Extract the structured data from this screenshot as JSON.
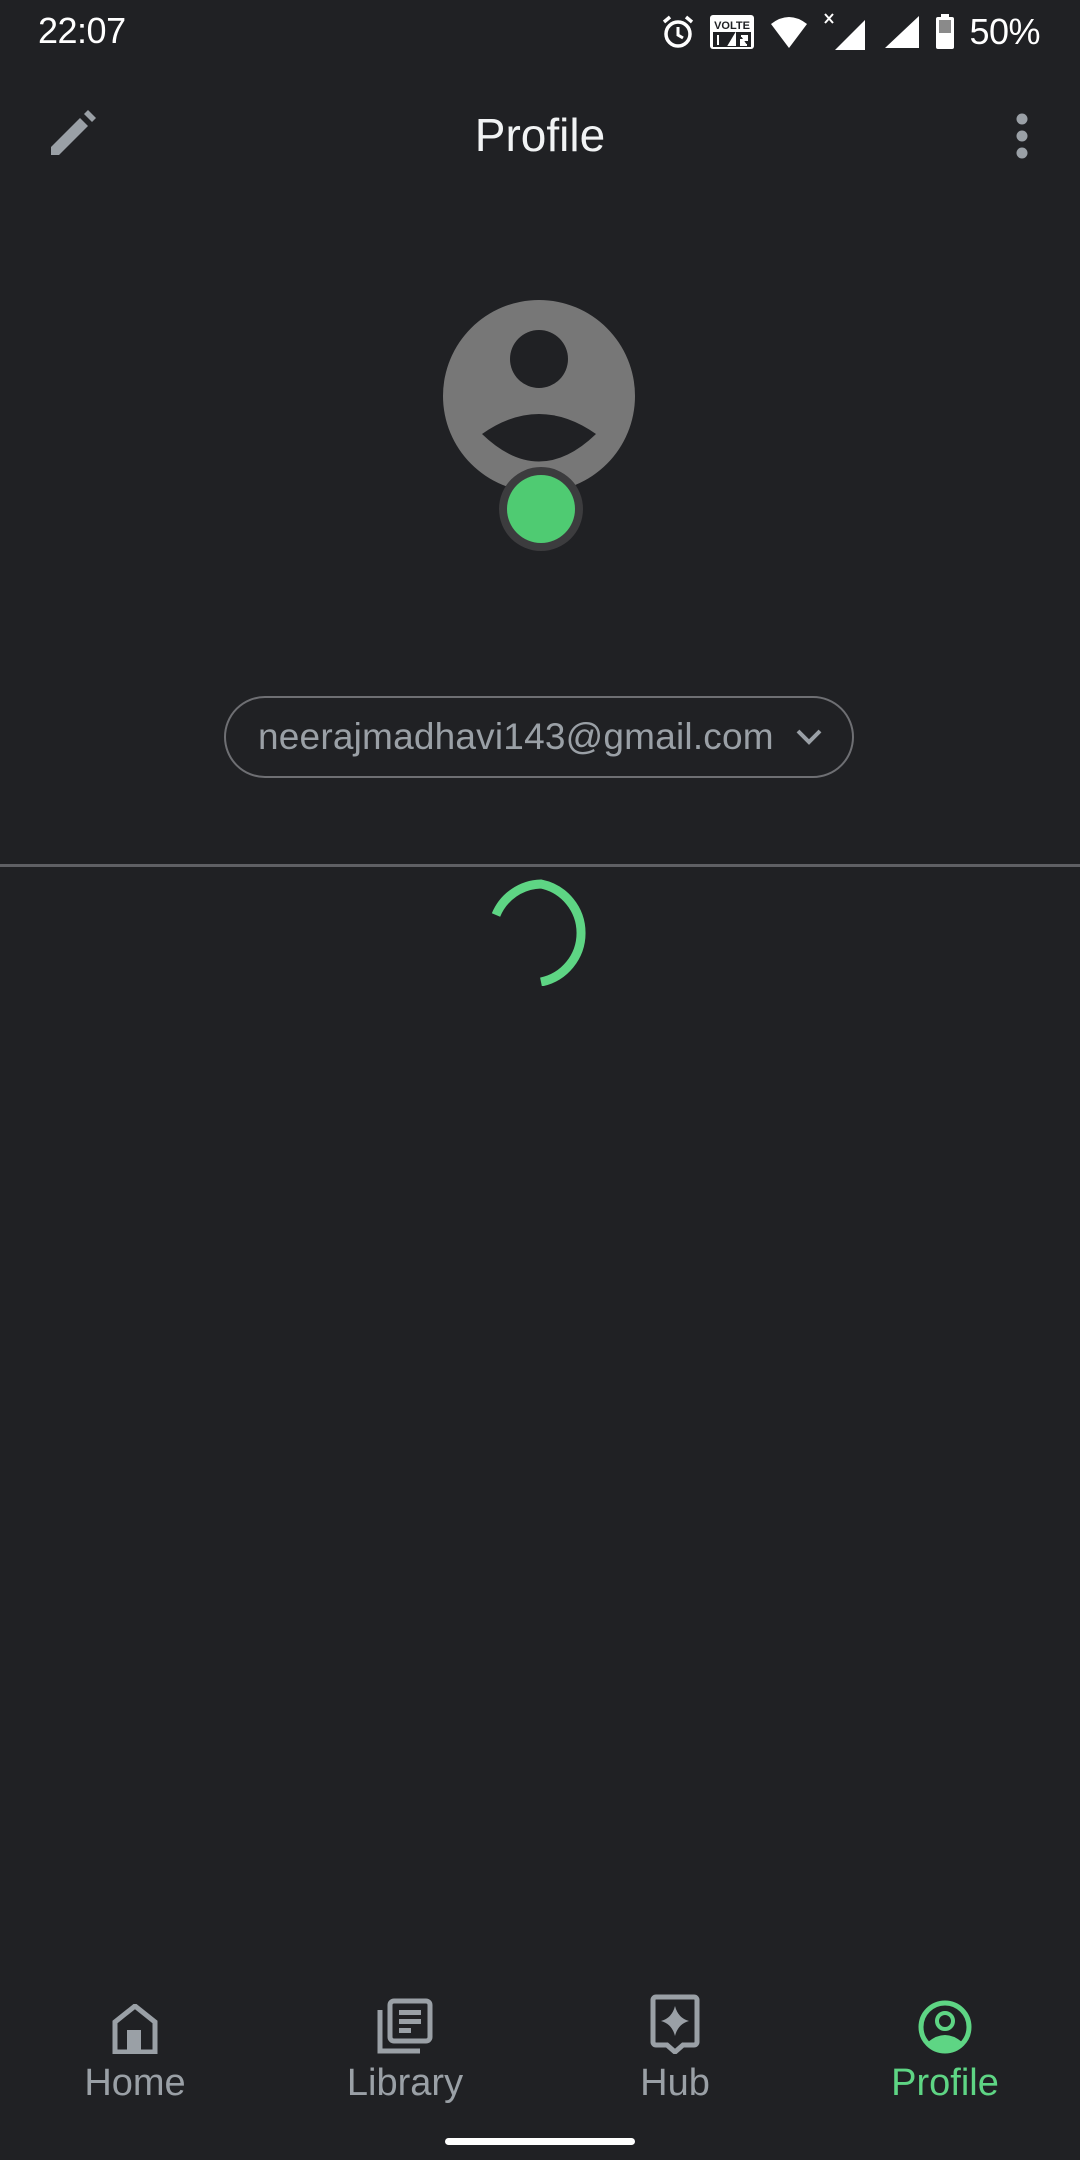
{
  "status_bar": {
    "time": "22:07",
    "icons": [
      "alarm-icon",
      "volte-icon",
      "wifi-icon",
      "signal-icon",
      "signal-icon",
      "battery-icon"
    ],
    "volte_label": "VOLTE",
    "battery_percent": "50%"
  },
  "app_bar": {
    "title": "Profile",
    "left_icon": "edit-icon",
    "right_icon": "more-vert-icon"
  },
  "profile": {
    "avatar_icon": "person-icon",
    "status_color": "#4fcb72",
    "account_email": "neerajmadhavi143@gmail.com",
    "chevron_icon": "chevron-down-icon"
  },
  "loading": {
    "indicator": "spinner",
    "color": "#5ed584"
  },
  "bottom_nav": {
    "active": "Profile",
    "accent_color": "#5ed584",
    "items": [
      {
        "label": "Home",
        "icon": "home-icon"
      },
      {
        "label": "Library",
        "icon": "library-icon"
      },
      {
        "label": "Hub",
        "icon": "hub-icon"
      },
      {
        "label": "Profile",
        "icon": "profile-icon"
      }
    ]
  }
}
